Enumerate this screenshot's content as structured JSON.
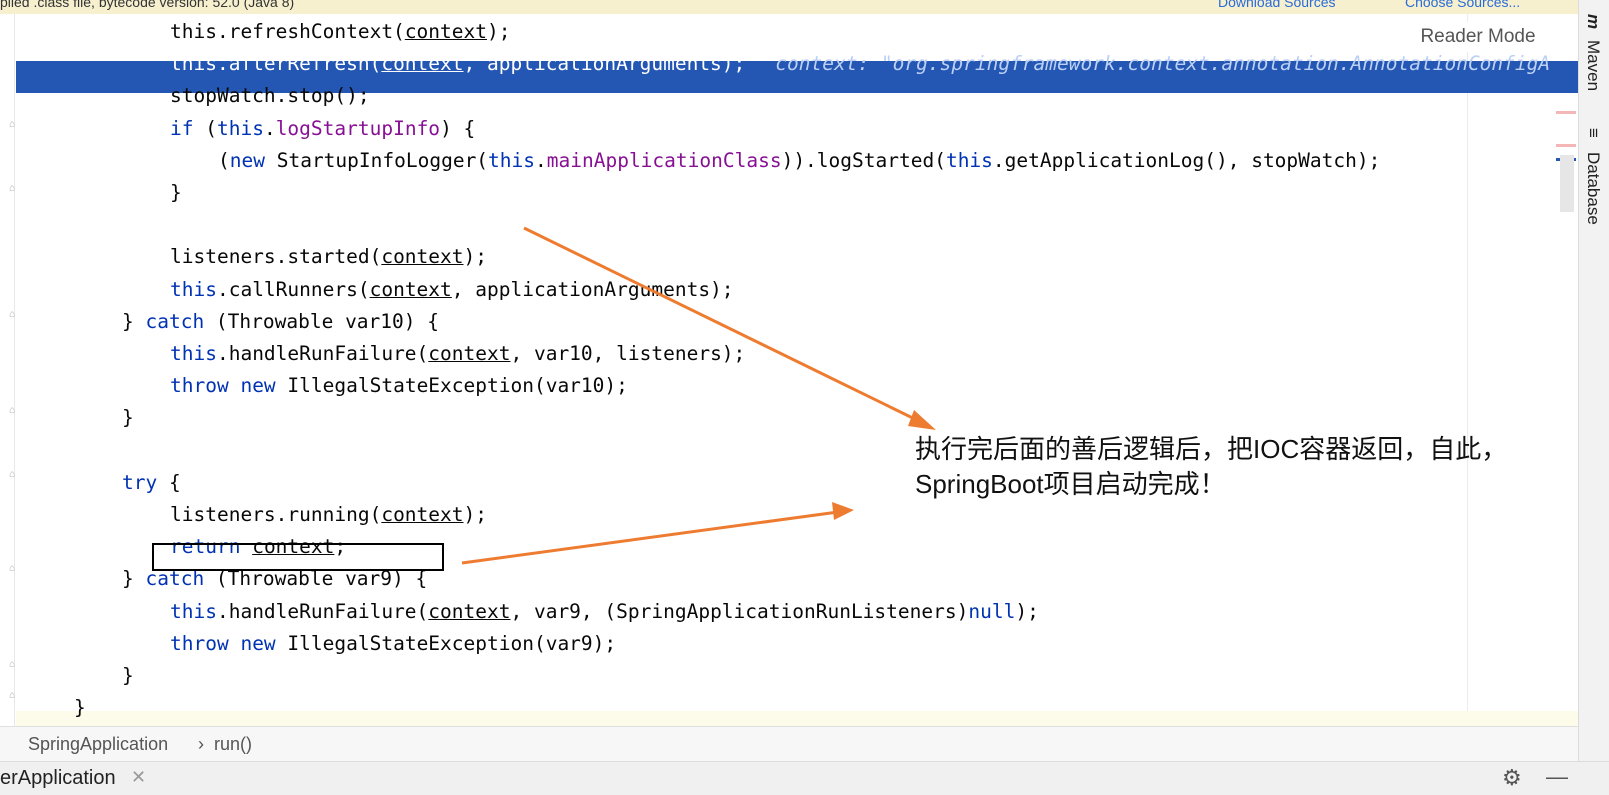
{
  "banner": {
    "info_text": "piled .class file, bytecode version: 52.0 (Java 8)",
    "download_link": "Download Sources",
    "choose_link": "Choose Sources..."
  },
  "editor": {
    "lines": [
      {
        "segments": [
          {
            "t": "this.refreshContext("
          },
          {
            "t": "context",
            "c": "ul"
          },
          {
            "t": ");"
          }
        ]
      },
      {
        "segments": [
          {
            "t": "this.afterRefresh("
          },
          {
            "t": "context",
            "c": "ul"
          },
          {
            "t": ", applicationArguments);"
          }
        ],
        "hint": "context: \"org.springframework.context.annotation.AnnotationConfigA"
      },
      {
        "segments": [
          {
            "t": "stopWatch.stop();"
          }
        ]
      },
      {
        "segments": [
          {
            "t": "if",
            "c": "kw"
          },
          {
            "t": " ("
          },
          {
            "t": "this",
            "c": "kw"
          },
          {
            "t": "."
          },
          {
            "t": "logStartupInfo",
            "c": "fld"
          },
          {
            "t": ") {"
          }
        ]
      },
      {
        "segments": [
          {
            "t": "("
          },
          {
            "t": "new",
            "c": "kw"
          },
          {
            "t": " StartupInfoLogger("
          },
          {
            "t": "this",
            "c": "kw"
          },
          {
            "t": "."
          },
          {
            "t": "mainApplicationClass",
            "c": "fld"
          },
          {
            "t": ")).logStarted("
          },
          {
            "t": "this",
            "c": "kw"
          },
          {
            "t": ".getApplicationLog(), stopWatch);"
          }
        ]
      },
      {
        "segments": [
          {
            "t": "}"
          }
        ]
      },
      {
        "segments": [
          {
            "t": ""
          }
        ]
      },
      {
        "segments": [
          {
            "t": "listeners.started("
          },
          {
            "t": "context",
            "c": "ul"
          },
          {
            "t": ");"
          }
        ]
      },
      {
        "segments": [
          {
            "t": "this",
            "c": "kw"
          },
          {
            "t": ".callRunners("
          },
          {
            "t": "context",
            "c": "ul"
          },
          {
            "t": ", applicationArguments);"
          }
        ]
      },
      {
        "segments": [
          {
            "t": "} "
          },
          {
            "t": "catch",
            "c": "kw"
          },
          {
            "t": " (Throwable var10) {"
          }
        ]
      },
      {
        "segments": [
          {
            "t": "this",
            "c": "kw"
          },
          {
            "t": ".handleRunFailure("
          },
          {
            "t": "context",
            "c": "ul"
          },
          {
            "t": ", var10, listeners);"
          }
        ]
      },
      {
        "segments": [
          {
            "t": "throw",
            "c": "kw"
          },
          {
            "t": " "
          },
          {
            "t": "new",
            "c": "kw"
          },
          {
            "t": " IllegalStateException(var10);"
          }
        ]
      },
      {
        "segments": [
          {
            "t": "}"
          }
        ]
      },
      {
        "segments": [
          {
            "t": ""
          }
        ]
      },
      {
        "segments": [
          {
            "t": "try",
            "c": "kw"
          },
          {
            "t": " {"
          }
        ]
      },
      {
        "segments": [
          {
            "t": "listeners.running("
          },
          {
            "t": "context",
            "c": "ul"
          },
          {
            "t": ");"
          }
        ]
      },
      {
        "segments": [
          {
            "t": "return",
            "c": "kw"
          },
          {
            "t": " "
          },
          {
            "t": "context",
            "c": "ul"
          },
          {
            "t": ";"
          }
        ]
      },
      {
        "segments": [
          {
            "t": "} "
          },
          {
            "t": "catch",
            "c": "kw"
          },
          {
            "t": " (Throwable var9) {"
          }
        ]
      },
      {
        "segments": [
          {
            "t": "this",
            "c": "kw"
          },
          {
            "t": ".handleRunFailure("
          },
          {
            "t": "context",
            "c": "ul"
          },
          {
            "t": ", var9, (SpringApplicationRunListeners)"
          },
          {
            "t": "null",
            "c": "kw"
          },
          {
            "t": ");"
          }
        ]
      },
      {
        "segments": [
          {
            "t": "throw",
            "c": "kw"
          },
          {
            "t": " "
          },
          {
            "t": "new",
            "c": "kw"
          },
          {
            "t": " IllegalStateException(var9);"
          }
        ]
      },
      {
        "segments": [
          {
            "t": "}"
          }
        ]
      },
      {
        "segments": [
          {
            "t": "}"
          }
        ]
      }
    ]
  },
  "reader_mode_label": "Reader Mode",
  "annotation": {
    "line1": "执行完后面的善后逻辑后，把IOC容器返回，自此，",
    "line2": "SpringBoot项目启动完成！"
  },
  "side_panel": {
    "maven_label": "Maven",
    "database_label": "Database"
  },
  "breadcrumb": {
    "class_name": "SpringApplication",
    "separator": "›",
    "method_name": "run()"
  },
  "tabbar": {
    "tab_label": "erApplication",
    "close_glyph": "✕",
    "gear_glyph": "⚙",
    "minimize_glyph": "—"
  },
  "colors": {
    "keyword": "#0033b3",
    "field": "#871094",
    "selection": "#2357b3",
    "arrow": "#ee7c30"
  }
}
